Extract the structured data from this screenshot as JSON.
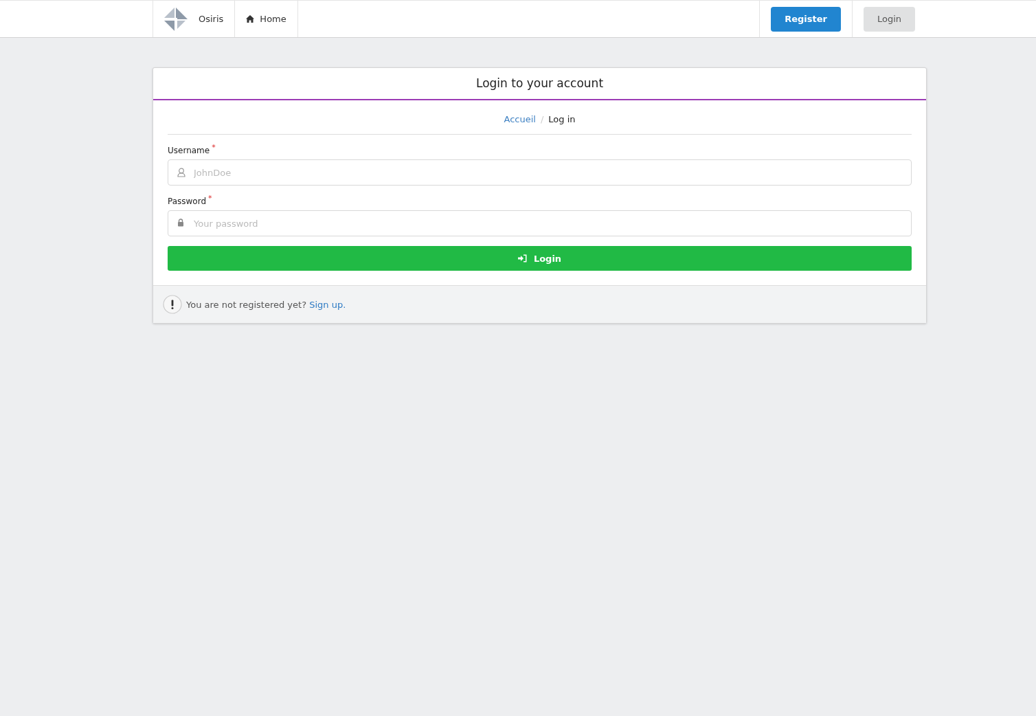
{
  "navbar": {
    "brand": "Osiris",
    "items": [
      {
        "label": "Home"
      }
    ],
    "register_button": "Register",
    "login_button": "Login"
  },
  "card": {
    "title": "Login to your account",
    "breadcrumb_divider": "/",
    "breadcrumb": [
      {
        "label": "Accueil",
        "kind": "link"
      },
      {
        "label": "Log in",
        "kind": "current"
      }
    ],
    "fields": [
      {
        "label": "Username",
        "required_mark": "*",
        "placeholder": "JohnDoe",
        "kind": "user"
      },
      {
        "label": "Password",
        "required_mark": "*",
        "placeholder": "Your password",
        "kind": "password"
      }
    ],
    "submit": "Login",
    "footer": {
      "text": "You are not registered yet?",
      "link": "Sign up."
    }
  }
}
